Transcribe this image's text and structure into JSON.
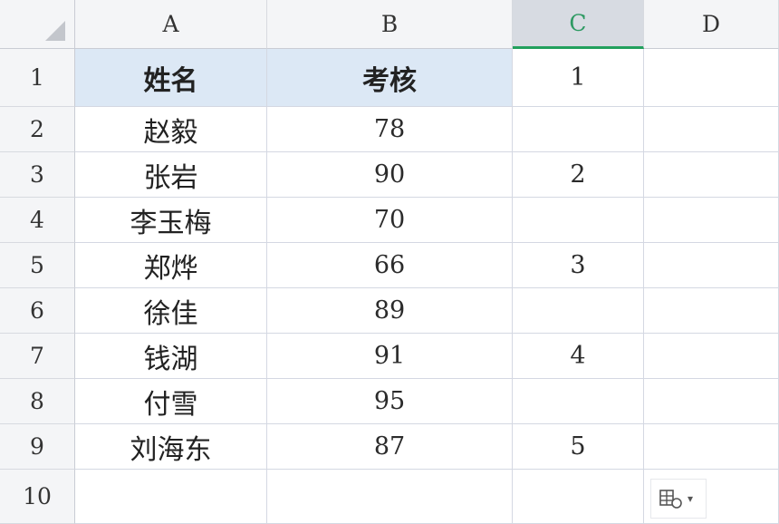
{
  "columns": [
    "A",
    "B",
    "C",
    "D"
  ],
  "selected_column": "C",
  "rows": [
    "1",
    "2",
    "3",
    "4",
    "5",
    "6",
    "7",
    "8",
    "9",
    "10"
  ],
  "cells": [
    [
      "姓名",
      "考核",
      "1",
      ""
    ],
    [
      "赵毅",
      "78",
      "",
      ""
    ],
    [
      "张岩",
      "90",
      "2",
      ""
    ],
    [
      "李玉梅",
      "70",
      "",
      ""
    ],
    [
      "郑烨",
      "66",
      "3",
      ""
    ],
    [
      "徐佳",
      "89",
      "",
      ""
    ],
    [
      "钱湖",
      "91",
      "4",
      ""
    ],
    [
      "付雪",
      "95",
      "",
      ""
    ],
    [
      "刘海东",
      "87",
      "5",
      ""
    ],
    [
      "",
      "",
      "",
      ""
    ]
  ],
  "colors": {
    "header_fill": "#dce8f5",
    "selection_accent": "#22a05d"
  },
  "paste_options_icon": "paste-options-icon"
}
